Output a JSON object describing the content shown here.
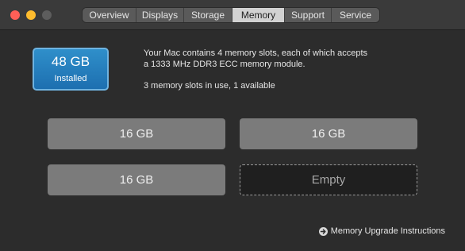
{
  "window": {
    "traffic_lights": {
      "close_color": "#fe5f57",
      "minimize_color": "#febc2e",
      "zoom_color": "#5d5d5d"
    }
  },
  "tabs": [
    {
      "label": "Overview",
      "active": false
    },
    {
      "label": "Displays",
      "active": false
    },
    {
      "label": "Storage",
      "active": false
    },
    {
      "label": "Memory",
      "active": true
    },
    {
      "label": "Support",
      "active": false
    },
    {
      "label": "Service",
      "active": false
    }
  ],
  "summary": {
    "total": "48 GB",
    "status": "Installed",
    "accent_color": "#2a84c4"
  },
  "description": {
    "line1": "Your Mac contains 4 memory slots, each of which accepts",
    "line2": "a 1333 MHz DDR3 ECC memory module.",
    "slots_status": "3 memory slots in use, 1 available"
  },
  "slots": [
    {
      "label": "16 GB",
      "state": "filled"
    },
    {
      "label": "16 GB",
      "state": "filled"
    },
    {
      "label": "16 GB",
      "state": "filled"
    },
    {
      "label": "Empty",
      "state": "empty"
    }
  ],
  "upgrade_link": {
    "label": "Memory Upgrade Instructions",
    "icon": "arrow-circle-right-icon"
  }
}
